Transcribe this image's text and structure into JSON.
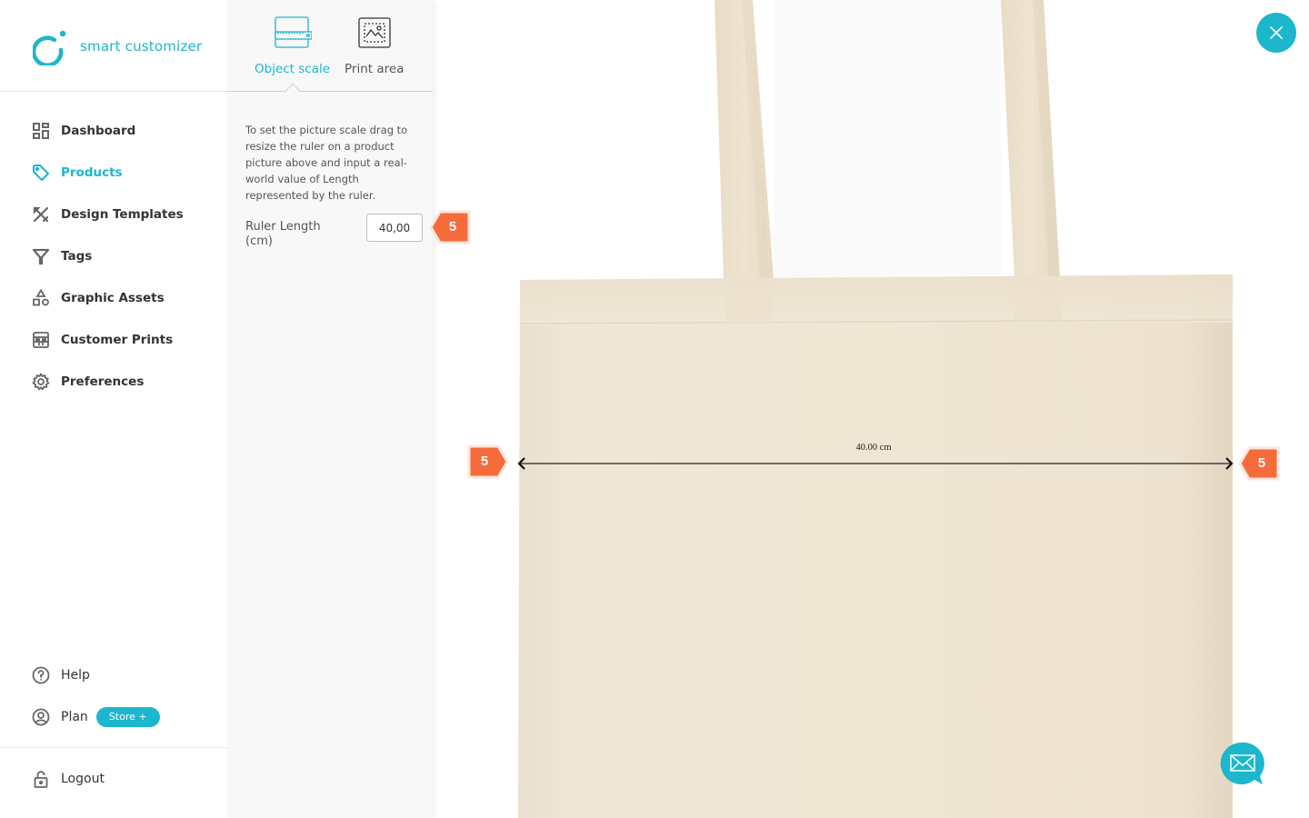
{
  "app": {
    "brand_name": "smart customizer",
    "accent_color": "#1cb6cd",
    "marker_color": "#f56b3a"
  },
  "sidebar": {
    "items": [
      {
        "label": "Dashboard",
        "icon": "dashboard-icon",
        "active": false
      },
      {
        "label": "Products",
        "icon": "tag-icon",
        "active": true
      },
      {
        "label": "Design Templates",
        "icon": "design-tools-icon",
        "active": false
      },
      {
        "label": "Tags",
        "icon": "filter-icon",
        "active": false
      },
      {
        "label": "Graphic Assets",
        "icon": "shapes-icon",
        "active": false
      },
      {
        "label": "Customer Prints",
        "icon": "prints-icon",
        "active": false
      },
      {
        "label": "Preferences",
        "icon": "gear-icon",
        "active": false
      }
    ],
    "help_label": "Help",
    "plan_label": "Plan",
    "plan_badge": "Store +",
    "logout_label": "Logout"
  },
  "panel": {
    "tabs": [
      {
        "label": "Object scale",
        "icon": "ruler-icon",
        "active": true
      },
      {
        "label": "Print area",
        "icon": "print-area-icon",
        "active": false
      }
    ],
    "description": "To set the picture scale drag to resize the ruler on a product picture above and input a real-world value of Length represented by the ruler.",
    "ruler_length_label": "Ruler Length (cm)",
    "ruler_length_value": "40,00"
  },
  "canvas": {
    "ruler_label": "40.00 cm",
    "markers": {
      "input_step": "5",
      "ruler_left_step": "5",
      "ruler_right_step": "5"
    }
  }
}
